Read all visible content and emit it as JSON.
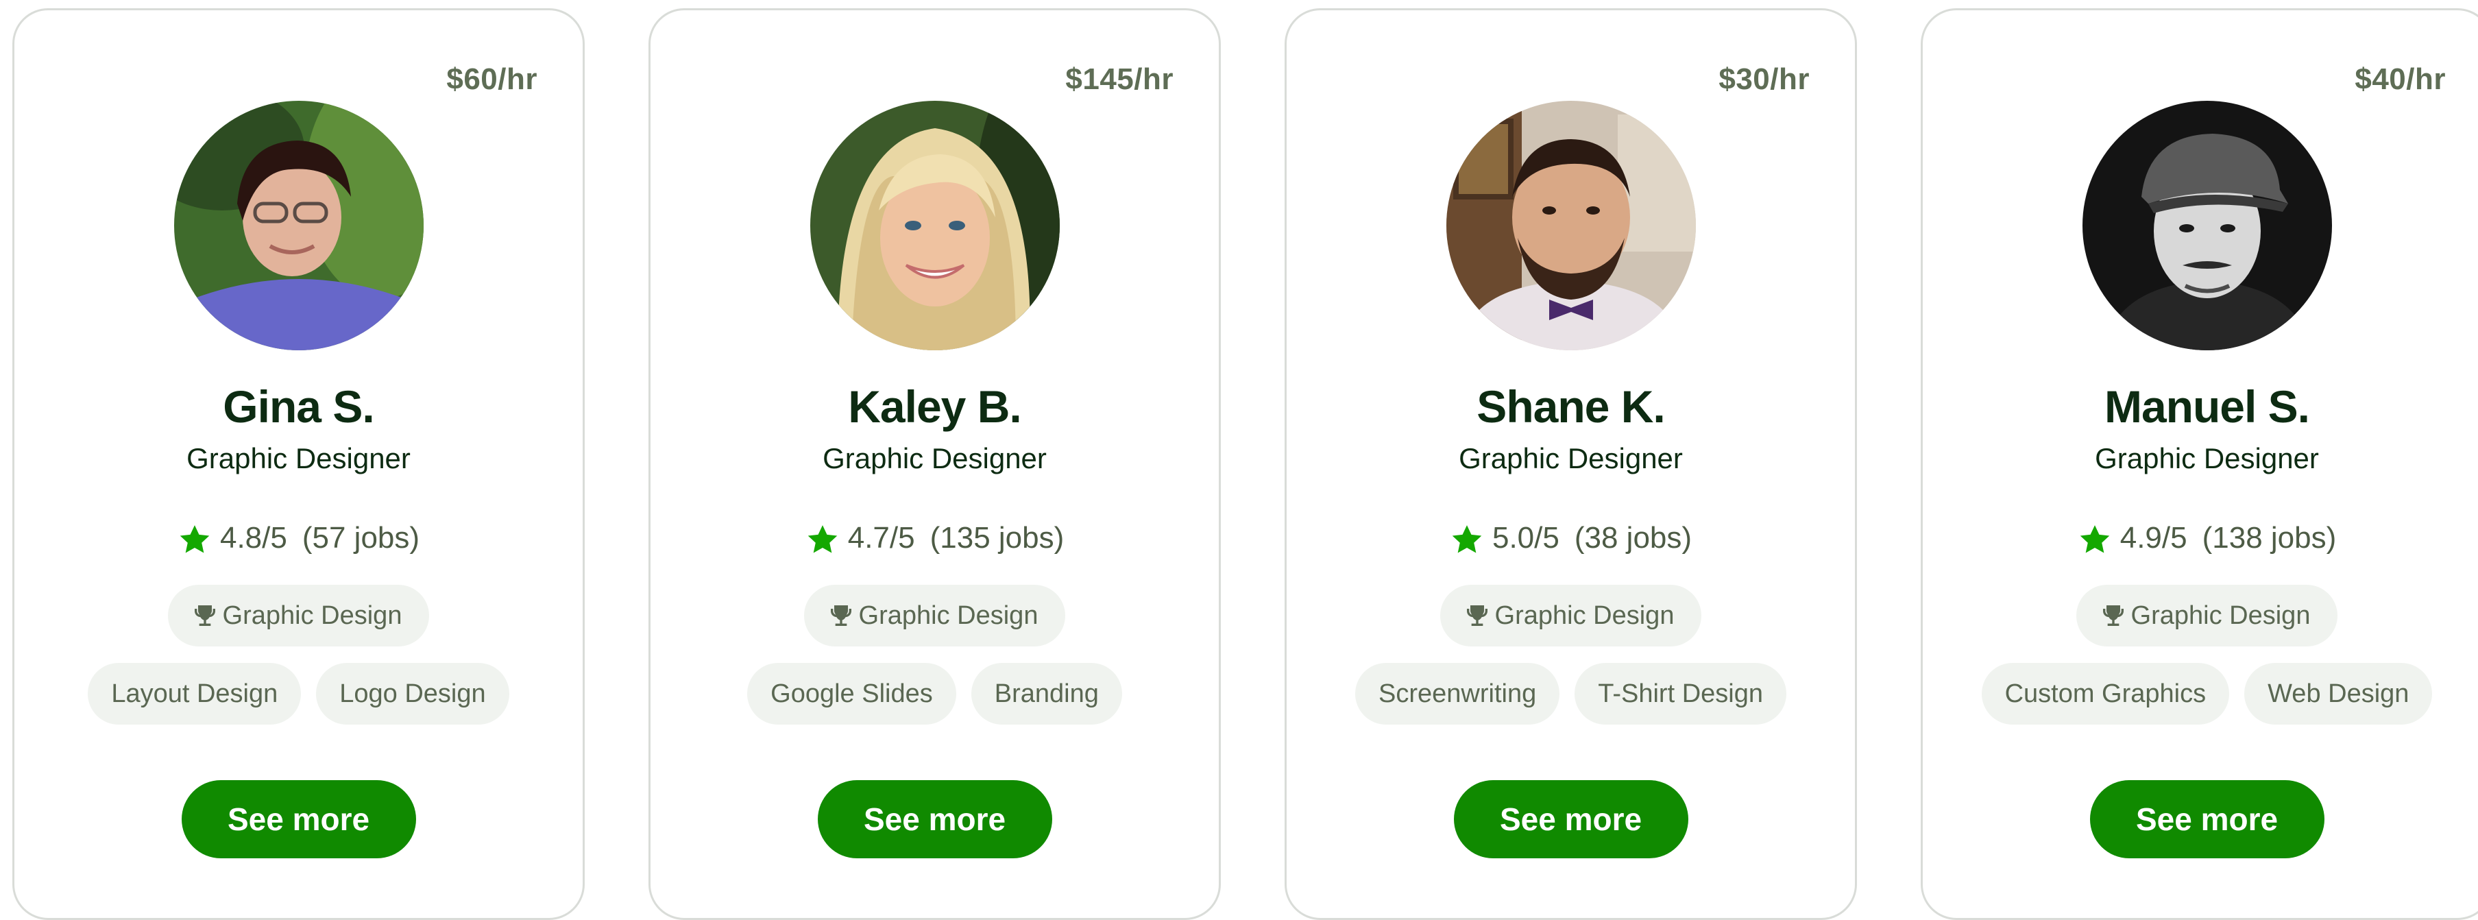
{
  "freelancers": [
    {
      "rate": "$60/hr",
      "avatar_alt": "Gina S.",
      "name": "Gina S.",
      "title": "Graphic Designer",
      "rating": "4.8/5",
      "jobs": "(57 jobs)",
      "badge": "Graphic Design",
      "skills": [
        "Layout Design",
        "Logo Design"
      ],
      "button": "See more"
    },
    {
      "rate": "$145/hr",
      "avatar_alt": "Kaley B.",
      "name": "Kaley B.",
      "title": "Graphic Designer",
      "rating": "4.7/5",
      "jobs": "(135 jobs)",
      "badge": "Graphic Design",
      "skills": [
        "Google Slides",
        "Branding"
      ],
      "button": "See more"
    },
    {
      "rate": "$30/hr",
      "avatar_alt": "Shane K.",
      "name": "Shane K.",
      "title": "Graphic Designer",
      "rating": "5.0/5",
      "jobs": "(38 jobs)",
      "badge": "Graphic Design",
      "skills": [
        "Screenwriting",
        "T-Shirt Design"
      ],
      "button": "See more"
    },
    {
      "rate": "$40/hr",
      "avatar_alt": "Manuel S.",
      "name": "Manuel S.",
      "title": "Graphic Designer",
      "rating": "4.9/5",
      "jobs": "(138 jobs)",
      "badge": "Graphic Design",
      "skills": [
        "Custom Graphics",
        "Web Design"
      ],
      "button": "See more"
    }
  ],
  "icons": {
    "star": "star-icon",
    "badge": "trophy-icon"
  },
  "colors": {
    "brand_green": "#108a00",
    "star_green": "#14a800",
    "text_dark": "#0d2b12",
    "text_muted": "#5e6d55",
    "chip_bg": "#f0f3ef",
    "card_border": "#d9dcd8"
  }
}
